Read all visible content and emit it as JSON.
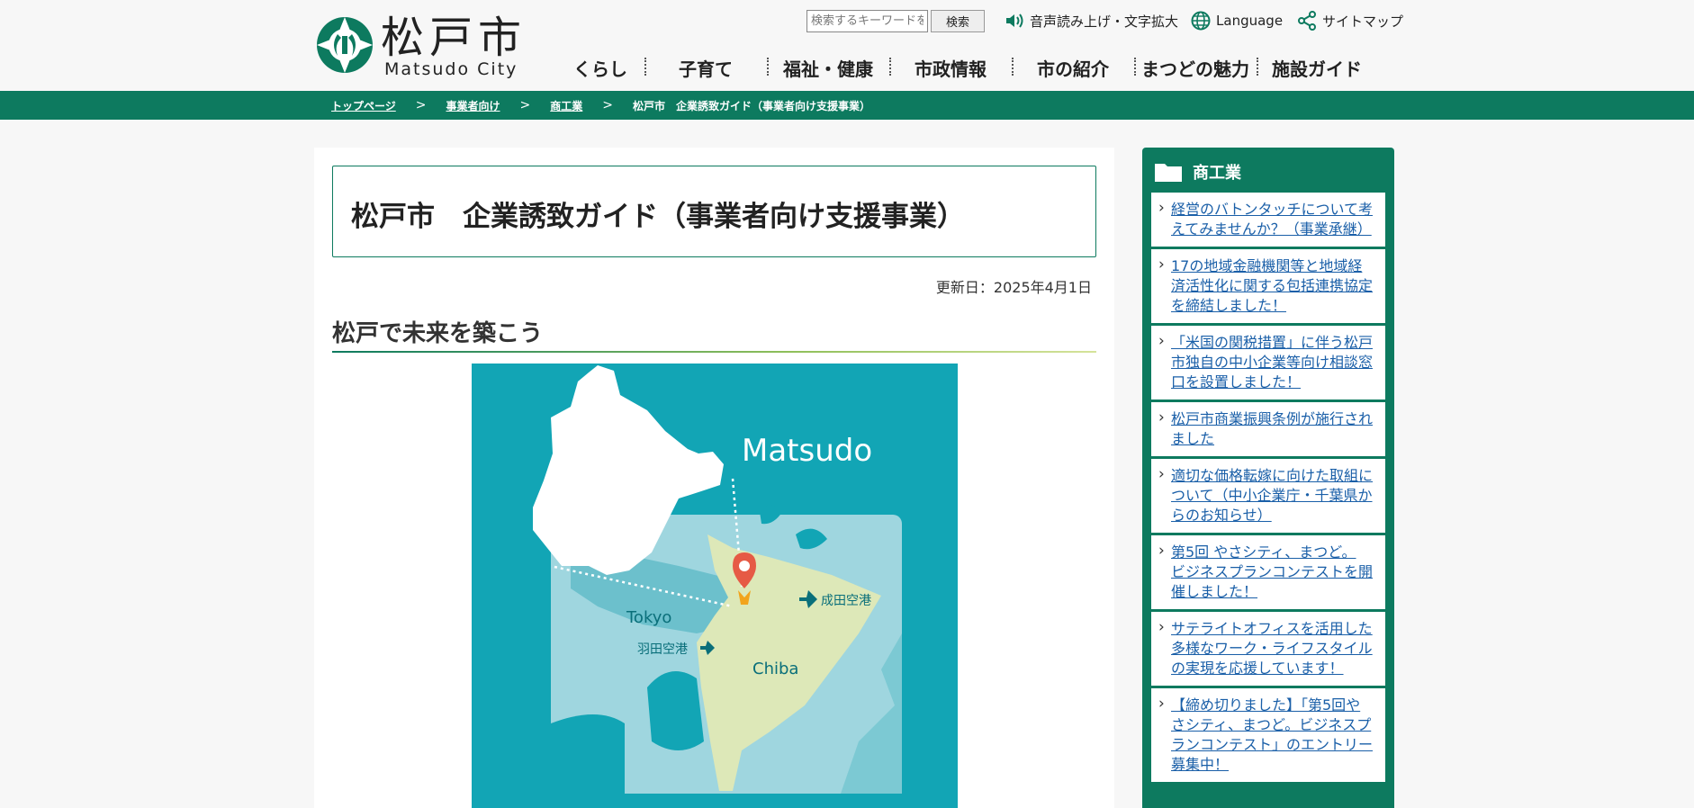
{
  "logo": {
    "name_ja": "松戸市",
    "name_en": "Matsudo City"
  },
  "header": {
    "search_placeholder": "検索するキーワードを",
    "search_button": "検索",
    "links": [
      "音声読み上げ・文字拡大",
      "Language",
      "サイトマップ"
    ]
  },
  "gnav": [
    "くらし",
    "子育て",
    "福祉・健康",
    "市政情報",
    "市の紹介",
    "まつどの魅力",
    "施設ガイド"
  ],
  "breadcrumb": {
    "links": [
      "トップページ",
      "事業者向け",
      "商工業"
    ],
    "separator": ">",
    "current": "松戸市　企業誘致ガイド（事業者向け支援事業）"
  },
  "main": {
    "title": "松戸市　企業誘致ガイド（事業者向け支援事業）",
    "updated": "更新日：2025年4月1日",
    "heading": "松戸で未来を築こう",
    "map_labels": {
      "city": "Matsudo",
      "tokyo": "Tokyo",
      "chiba": "Chiba",
      "narita": "成田空港",
      "haneda": "羽田空港"
    }
  },
  "sidebar": {
    "title": "商工業",
    "items": [
      "経営のバトンタッチについて考えてみませんか？（事業承継）",
      "17の地域金融機関等と地域経済活性化に関する包括連携協定を締結しました！",
      "「米国の関税措置」に伴う松戸市独自の中小企業等向け相談窓口を設置しました！",
      "松戸市商業振興条例が施行されました",
      "適切な価格転嫁に向けた取組について（中小企業庁・千葉県からのお知らせ）",
      "第5回 やさシティ、まつど。 ビジネスプランコンテストを開催しました！",
      "サテライトオフィスを活用した多様なワーク・ライフスタイルの実現を応援しています！",
      "【締め切りました】「第5回やさシティ、まつど。ビジネスプランコンテスト」のエントリー募集中！"
    ]
  },
  "colors": {
    "brand_green": "#0d7a5f",
    "link_blue": "#1a5fa8",
    "map_teal": "#12a5b5"
  }
}
